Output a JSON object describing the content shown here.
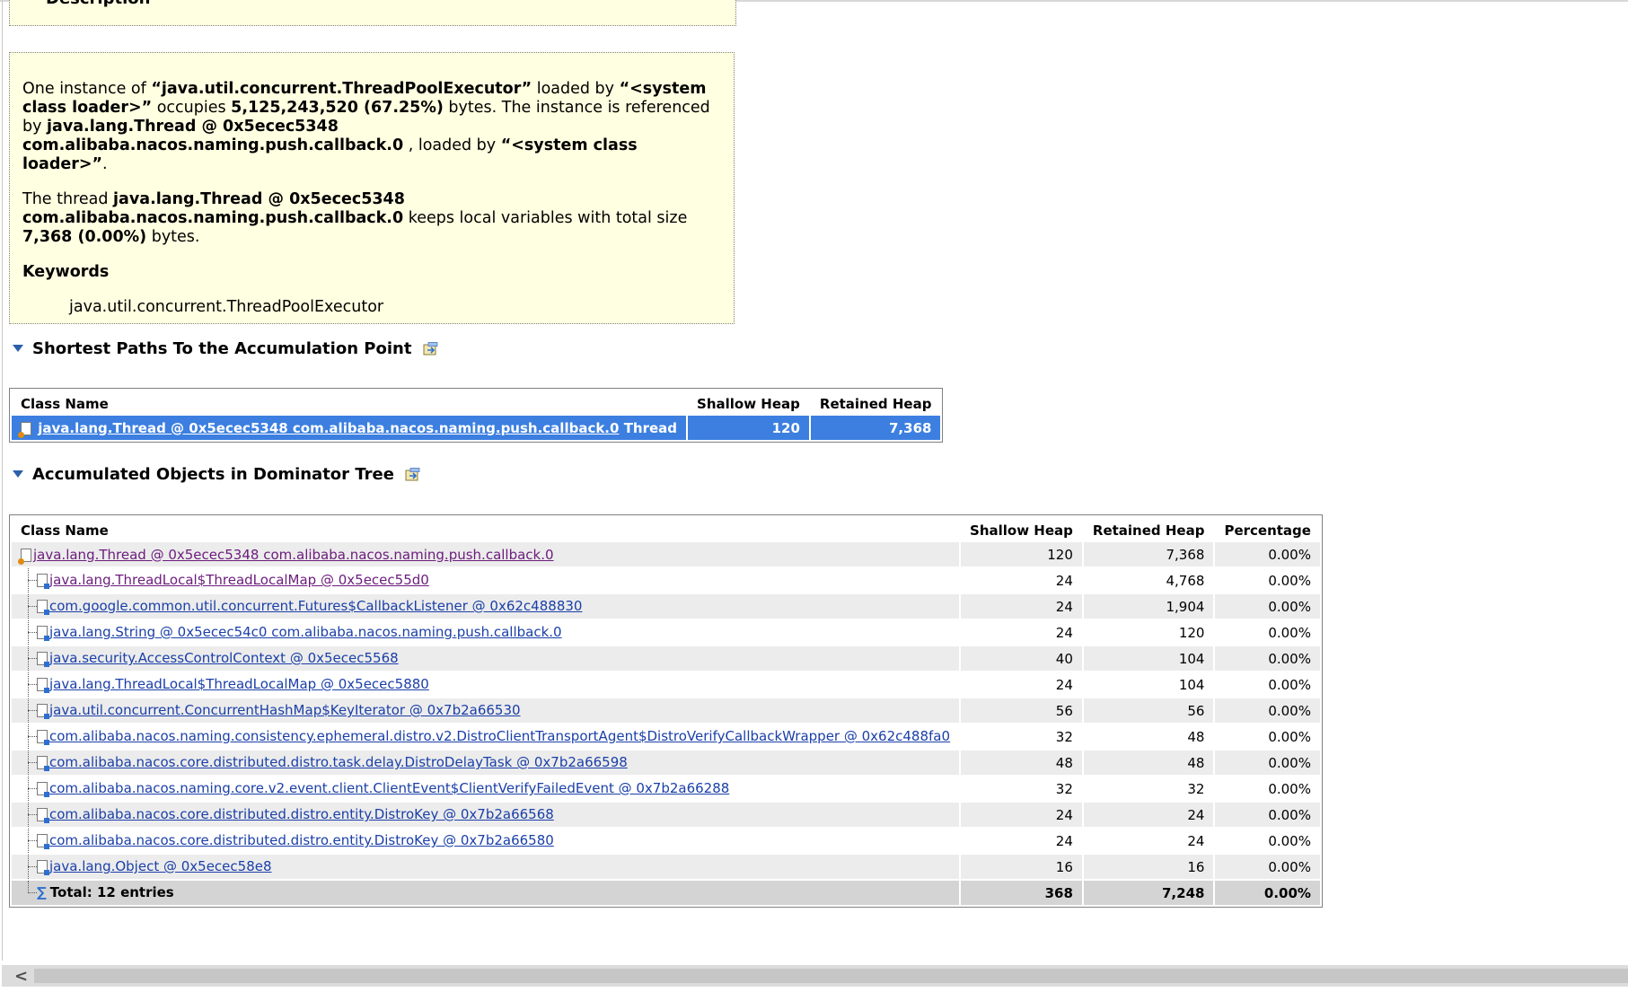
{
  "description": {
    "header": "Description",
    "para1": {
      "t1": "One instance of ",
      "b1": "“java.util.concurrent.ThreadPoolExecutor”",
      "t2": " loaded by ",
      "b2": "“<system class loader>”",
      "t3": " occupies ",
      "b3": "5,125,243,520 (67.25%)",
      "t4": " bytes. The instance is referenced by ",
      "b4": "java.lang.Thread @ 0x5ecec5348 com.alibaba.nacos.naming.push.callback.0",
      "t5": " , loaded by ",
      "b5": "“<system class loader>”",
      "t6": "."
    },
    "para2": {
      "t1": "The thread ",
      "b1": "java.lang.Thread @ 0x5ecec5348 com.alibaba.nacos.naming.push.callback.0",
      "t2": " keeps local variables with total size ",
      "b2": "7,368 (0.00%)",
      "t3": " bytes."
    },
    "keywords_label": "Keywords",
    "keyword": "java.util.concurrent.ThreadPoolExecutor"
  },
  "shortest_paths": {
    "title": "Shortest Paths To the Accumulation Point",
    "headers": {
      "class_name": "Class Name",
      "shallow": "Shallow Heap",
      "retained": "Retained Heap"
    },
    "row": {
      "link": "java.lang.Thread @ 0x5ecec5348 com.alibaba.nacos.naming.push.callback.0",
      "suffix": "Thread",
      "shallow": "120",
      "retained": "7,368"
    }
  },
  "accumulated": {
    "title": "Accumulated Objects in Dominator Tree",
    "headers": {
      "class_name": "Class Name",
      "shallow": "Shallow Heap",
      "retained": "Retained Heap",
      "percentage": "Percentage"
    },
    "root": {
      "name": "java.lang.Thread @ 0x5ecec5348 com.alibaba.nacos.naming.push.callback.0",
      "shallow": "120",
      "retained": "7,368",
      "pct": "0.00%"
    },
    "children": [
      {
        "name": "java.lang.ThreadLocal$ThreadLocalMap @ 0x5ecec55d0",
        "shallow": "24",
        "retained": "4,768",
        "pct": "0.00%"
      },
      {
        "name": "com.google.common.util.concurrent.Futures$CallbackListener @ 0x62c488830",
        "shallow": "24",
        "retained": "1,904",
        "pct": "0.00%"
      },
      {
        "name": "java.lang.String @ 0x5ecec54c0 com.alibaba.nacos.naming.push.callback.0",
        "shallow": "24",
        "retained": "120",
        "pct": "0.00%"
      },
      {
        "name": "java.security.AccessControlContext @ 0x5ecec5568",
        "shallow": "40",
        "retained": "104",
        "pct": "0.00%"
      },
      {
        "name": "java.lang.ThreadLocal$ThreadLocalMap @ 0x5ecec5880",
        "shallow": "24",
        "retained": "104",
        "pct": "0.00%"
      },
      {
        "name": "java.util.concurrent.ConcurrentHashMap$KeyIterator @ 0x7b2a66530",
        "shallow": "56",
        "retained": "56",
        "pct": "0.00%"
      },
      {
        "name": "com.alibaba.nacos.naming.consistency.ephemeral.distro.v2.DistroClientTransportAgent$DistroVerifyCallbackWrapper @ 0x62c488fa0",
        "shallow": "32",
        "retained": "48",
        "pct": "0.00%"
      },
      {
        "name": "com.alibaba.nacos.core.distributed.distro.task.delay.DistroDelayTask @ 0x7b2a66598",
        "shallow": "48",
        "retained": "48",
        "pct": "0.00%"
      },
      {
        "name": "com.alibaba.nacos.naming.core.v2.event.client.ClientEvent$ClientVerifyFailedEvent @ 0x7b2a66288",
        "shallow": "32",
        "retained": "32",
        "pct": "0.00%"
      },
      {
        "name": "com.alibaba.nacos.core.distributed.distro.entity.DistroKey @ 0x7b2a66568",
        "shallow": "24",
        "retained": "24",
        "pct": "0.00%"
      },
      {
        "name": "com.alibaba.nacos.core.distributed.distro.entity.DistroKey @ 0x7b2a66580",
        "shallow": "24",
        "retained": "24",
        "pct": "0.00%"
      },
      {
        "name": "java.lang.Object @ 0x5ecec58e8",
        "shallow": "16",
        "retained": "16",
        "pct": "0.00%"
      }
    ],
    "total": {
      "label": "Total: 12 entries",
      "shallow": "368",
      "retained": "7,248",
      "pct": "0.00%"
    }
  },
  "icons": {
    "collapse": "triangle-down-icon",
    "export": "export-icon",
    "object": "object-instance-icon",
    "thread": "thread-object-icon",
    "sum": "sigma-icon",
    "scroll_left": "chevron-left-icon"
  },
  "colors": {
    "description_bg": "#ffffe1",
    "selection": "#3c7fe0",
    "link": "#1a3fa8",
    "visited_link": "#6b1c7c",
    "alt_row": "#ececec",
    "total_row": "#d4d4d4"
  }
}
